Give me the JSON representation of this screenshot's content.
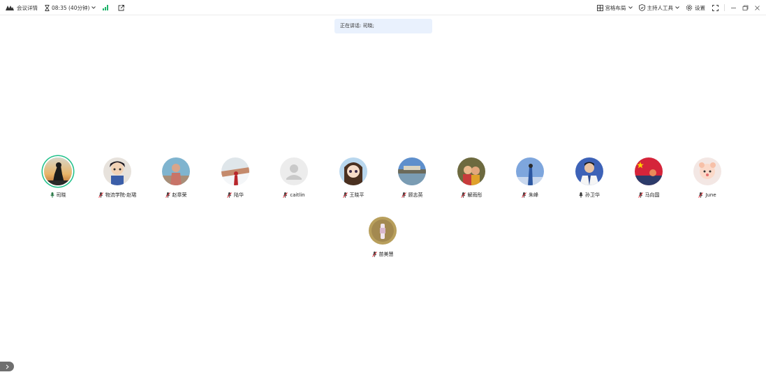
{
  "topbar": {
    "meeting_info_label": "会议详情",
    "timer": "08:35 (40分钟)",
    "grid_layout_label": "宫格布局",
    "host_tools_label": "主持人工具",
    "settings_label": "设置",
    "accent": "#20c08a"
  },
  "speaking": {
    "text": "正在讲话: 司晓;"
  },
  "participants": [
    {
      "name": "司晓",
      "mic": "on"
    },
    {
      "name": "物流学院-赵珺",
      "mic": "muted"
    },
    {
      "name": "赵章荣",
      "mic": "muted"
    },
    {
      "name": "陆华",
      "mic": "muted"
    },
    {
      "name": "caitlin",
      "mic": "muted"
    },
    {
      "name": "王晓平",
      "mic": "muted"
    },
    {
      "name": "顾志英",
      "mic": "muted"
    },
    {
      "name": "解雨彤",
      "mic": "muted"
    },
    {
      "name": "朱峰",
      "mic": "muted"
    },
    {
      "name": "孙卫华",
      "mic": "on"
    },
    {
      "name": "马向国",
      "mic": "muted"
    },
    {
      "name": "June",
      "mic": "muted"
    },
    {
      "name": "苗美慧",
      "mic": "muted"
    }
  ]
}
